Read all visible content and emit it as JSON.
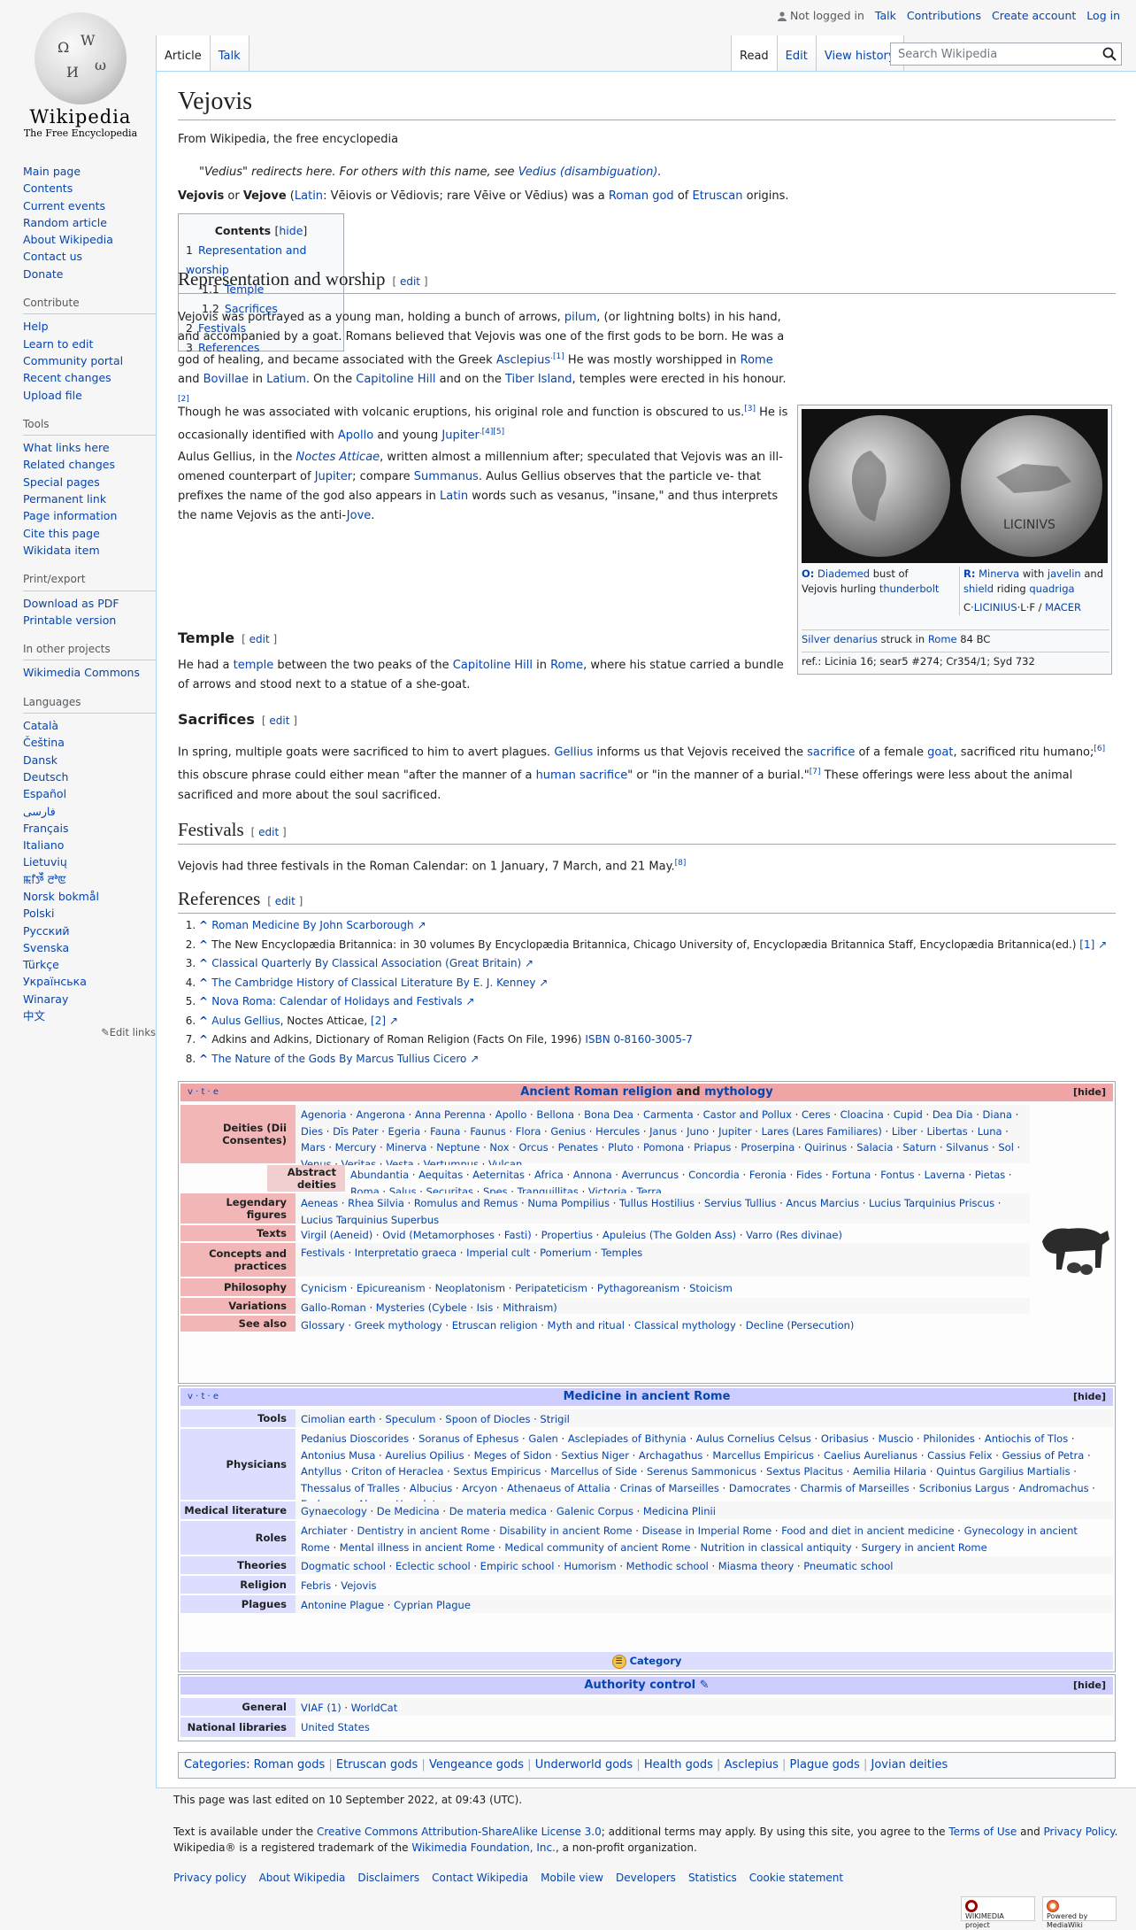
{
  "branding": {
    "wordmark": "Wikipedia",
    "tagline": "The Free Encyclopedia"
  },
  "personal": {
    "not_logged_in": "Not logged in",
    "talk": "Talk",
    "contributions": "Contributions",
    "create_account": "Create account",
    "login": "Log in"
  },
  "tabs": {
    "article": "Article",
    "talk": "Talk",
    "read": "Read",
    "edit": "Edit",
    "history": "View history"
  },
  "search": {
    "placeholder": "Search Wikipedia"
  },
  "sidebar": {
    "main": [
      "Main page",
      "Contents",
      "Current events",
      "Random article",
      "About Wikipedia",
      "Contact us",
      "Donate"
    ],
    "contribute_heading": "Contribute",
    "contribute": [
      "Help",
      "Learn to edit",
      "Community portal",
      "Recent changes",
      "Upload file"
    ],
    "tools_heading": "Tools",
    "tools": [
      "What links here",
      "Related changes",
      "Special pages",
      "Permanent link",
      "Page information",
      "Cite this page",
      "Wikidata item"
    ],
    "print_heading": "Print/export",
    "print": [
      "Download as PDF",
      "Printable version"
    ],
    "projects_heading": "In other projects",
    "projects": [
      "Wikimedia Commons"
    ],
    "languages_heading": "Languages",
    "languages": [
      "Català",
      "Čeština",
      "Dansk",
      "Deutsch",
      "Español",
      "فارسی",
      "Français",
      "Italiano",
      "Lietuvių",
      "ꯃꯤꯇꯩ ꯂꯣꯟ",
      "Norsk bokmål",
      "Polski",
      "Русский",
      "Svenska",
      "Türkçe",
      "Українська",
      "Winaray",
      "中文"
    ],
    "edit_links": "Edit links"
  },
  "article": {
    "title": "Vejovis",
    "from": "From Wikipedia, the free encyclopedia",
    "hatnote_pre": "\"Vedius\" redirects here. For others with this name, see ",
    "hatnote_link": "Vedius (disambiguation)",
    "hatnote_post": ".",
    "lead_bold1": "Vejovis",
    "lead_or": " or ",
    "lead_bold2": "Vejove",
    "lead_paren1": " (",
    "lead_latin": "Latin",
    "lead_forms": ": Vēiovis or Vēdiovis; rare Vēive or Vēdius) was a ",
    "lead_roman_god": "Roman god",
    "lead_of": " of ",
    "lead_etruscan": "Etruscan",
    "lead_end": " origins."
  },
  "toc": {
    "title": "Contents",
    "hide": "hide",
    "items": [
      {
        "num": "1",
        "label": "Representation and worship"
      },
      {
        "num": "1.1",
        "label": "Temple"
      },
      {
        "num": "1.2",
        "label": "Sacrifices"
      },
      {
        "num": "2",
        "label": "Festivals"
      },
      {
        "num": "3",
        "label": "References"
      }
    ]
  },
  "sections": {
    "rep_heading": "Representation and worship",
    "edit": "edit",
    "p1a": "Vejovis was portrayed as a young man, holding a bunch of arrows, ",
    "p1_pilum": "pilum",
    "p1b": ", (or lightning bolts) in his hand, and accompanied by a goat. Romans believed that Vejovis was one of the first gods to be born. He was a god of healing, and became associated with the Greek ",
    "p1_asclepius": "Asclepius",
    "p1_ref1": ".[1]",
    "p1c": " He was mostly worshipped in ",
    "p1_rome": "Rome",
    "p1_and": " and ",
    "p1_bovillae": "Bovillae",
    "p1_in": " in ",
    "p1_latium": "Latium",
    "p1d": ". On the ",
    "p1_capitoline": "Capitoline Hill",
    "p1e": " and on the ",
    "p1_tiber": "Tiber Island",
    "p1f": ", temples were erected in his honour.",
    "p1_ref2": "[2]",
    "p2a": "Though he was associated with volcanic eruptions, his original role and function is obscured to us.",
    "p2_ref3": "[3]",
    "p2b": " He is occasionally identified with ",
    "p2_apollo": "Apollo",
    "p2c": " and young ",
    "p2_jupiter": "Jupiter",
    "p2_ref45": ".[4][5]",
    "p3a": "Aulus Gellius, in the ",
    "p3_noctes": "Noctes Atticae",
    "p3b": ", written almost a millennium after; speculated that Vejovis was an ill-omened counterpart of ",
    "p3_jupiter": "Jupiter",
    "p3c": "; compare ",
    "p3_summanus": "Summanus",
    "p3d": ". Aulus Gellius observes that the particle ve- that prefixes the name of the god also appears in ",
    "p3_latin": "Latin",
    "p3e": " words such as vesanus, \"insane,\" and thus interprets the name Vejovis as the anti-",
    "p3_jove": "Jove",
    "p3f": ".",
    "temple_heading": "Temple",
    "t1a": "He had a ",
    "t1_temple": "temple",
    "t1b": " between the two peaks of the ",
    "t1_capitoline": "Capitoline Hill",
    "t1c": " in ",
    "t1_rome": "Rome",
    "t1d": ", where his statue carried a bundle of arrows and stood next to a statue of a she-goat.",
    "sacrifices_heading": "Sacrifices",
    "s1a": "In spring, multiple goats were sacrificed to him to avert plagues. ",
    "s1_gellius": "Gellius",
    "s1b": " informs us that Vejovis received the ",
    "s1_sacrifice": "sacrifice",
    "s1c": " of a female ",
    "s1_goat": "goat",
    "s1d": ", sacrificed ritu humano;",
    "s1_ref6": "[6]",
    "s1e": " this obscure phrase could either mean \"after the manner of a ",
    "s1_human": "human sacrifice",
    "s1f": "\" or \"in the manner of a burial.\"",
    "s1_ref7": "[7]",
    "s1g": " These offerings were less about the animal sacrificed and more about the soul sacrificed.",
    "festivals_heading": "Festivals",
    "f1": "Vejovis had three festivals in the Roman Calendar: on 1 January, 7 March, and 21 May.",
    "f1_ref8": "[8]",
    "references_heading": "References"
  },
  "infobox": {
    "o_label": "O:",
    "o_diademed": "Diademed",
    "o_text": " bust of Vejovis hurling ",
    "o_thunderbolt": "thunderbolt",
    "r_label": "R:",
    "r_minerva": "Minerva",
    "r_with": " with ",
    "r_javelin": "javelin",
    "r_and": " and ",
    "r_shield": "shield",
    "r_riding": " riding ",
    "r_quadriga": "quadriga",
    "r_legend_c": "C·",
    "r_licinius": "LICINIUS",
    "r_lf": "·L·F / ",
    "r_macer": "MACER",
    "denarius": "Silver denarius",
    "struck": " struck in ",
    "rome": "Rome",
    "year": " 84 BC",
    "ref": "ref.: Licinia 16; sear5 #274; Cr354/1; Syd 732",
    "coin_legend": "LICINIVS"
  },
  "references": [
    {
      "text": "Roman Medicine By John Scarborough",
      "type": "link"
    },
    {
      "text": "The New Encyclopædia Britannica: in 30 volumes By Encyclopædia Britannica, Chicago University of, Encyclopædia Britannica Staff, Encyclopædia Britannica(ed.) ",
      "link": "[1]",
      "type": "mixed"
    },
    {
      "text": "Classical Quarterly By Classical Association (Great Britain)",
      "type": "link"
    },
    {
      "text": "The Cambridge History of Classical Literature By E. J. Kenney",
      "type": "link"
    },
    {
      "text": "Nova Roma: Calendar of Holidays and Festivals",
      "type": "link"
    },
    {
      "text": "Aulus Gellius",
      "rest": ", Noctes Atticae, ",
      "link": "[2]",
      "type": "gellius"
    },
    {
      "text": "Adkins and Adkins, Dictionary of Roman Religion (Facts On File, 1996) ",
      "link": "ISBN 0-8160-3005-7",
      "type": "isbn"
    },
    {
      "text": "The Nature of the Gods By Marcus Tullius Cicero",
      "type": "link"
    }
  ],
  "navbox_religion": {
    "vte": "v · t · e",
    "title_a": "Ancient Roman religion",
    "title_and": " and ",
    "title_b": "mythology",
    "hide": "[hide]",
    "rows": [
      {
        "group": "Deities (Dii Consentes)",
        "items": "Agenoria · Angerona · Anna Perenna · Apollo · Bellona · Bona Dea · Carmenta · Castor and Pollux · Ceres · Cloacina · Cupid · Dea Dia · Diana · Dies · Dīs Pater · Egeria · Fauna · Faunus · Flora · Genius · Hercules · Janus · Juno · Jupiter · Lares (Lares Familiares) · Liber · Libertas · Luna · Mars · Mercury · Minerva · Neptune · Nox · Orcus · Penates · Pluto · Pomona · Priapus · Proserpina · Quirinus · Salacia · Saturn · Silvanus · Sol · Venus · Veritas · Vesta · Vertumnus · Vulcan"
      },
      {
        "group": "Abstract deities",
        "items": "Abundantia · Aequitas · Aeternitas · Africa · Annona · Averruncus · Concordia · Feronia · Fides · Fortuna · Fontus · Laverna · Pietas · Roma · Salus · Securitas · Spes · Tranquillitas · Victoria · Terra"
      },
      {
        "group": "Legendary figures",
        "items": "Aeneas · Rhea Silvia · Romulus and Remus · Numa Pompilius · Tullus Hostilius · Servius Tullius · Ancus Marcius · Lucius Tarquinius Priscus · Lucius Tarquinius Superbus"
      },
      {
        "group": "Texts",
        "items": "Virgil (Aeneid) · Ovid (Metamorphoses · Fasti) · Propertius · Apuleius (The Golden Ass) · Varro (Res divinae)"
      },
      {
        "group": "Concepts and practices",
        "items": "Festivals · Interpretatio graeca · Imperial cult · Pomerium · Temples"
      },
      {
        "group": "Philosophy",
        "items": "Cynicism · Epicureanism · Neoplatonism · Peripateticism · Pythagoreanism · Stoicism"
      },
      {
        "group": "Variations",
        "items": "Gallo-Roman · Mysteries (Cybele · Isis · Mithraism)"
      },
      {
        "group": "See also",
        "items": "Glossary · Greek mythology · Etruscan religion · Myth and ritual · Classical mythology · Decline (Persecution)"
      }
    ]
  },
  "navbox_medicine": {
    "vte": "v · t · e",
    "title": "Medicine in ancient Rome",
    "hide": "[hide]",
    "rows": [
      {
        "group": "Tools",
        "items": "Cimolian earth · Speculum · Spoon of Diocles · Strigil"
      },
      {
        "group": "Physicians",
        "items": "Pedanius Dioscorides · Soranus of Ephesus · Galen · Asclepiades of Bithynia · Aulus Cornelius Celsus · Oribasius · Muscio · Philonides · Antiochis of Tlos · Antonius Musa · Aurelius Opilius · Meges of Sidon · Sextius Niger · Archagathus · Marcellus Empiricus · Caelius Aurelianus · Cassius Felix · Gessius of Petra · Antyllus · Criton of Heraclea · Sextus Empiricus · Marcellus of Side · Serenus Sammonicus · Sextus Placitus · Aemilia Hilaria · Quintus Gargilius Martialis · Thessalus of Tralles · Albucius · Arcyon · Athenaeus of Attalia · Crinas of Marseilles · Damocrates · Charmis of Marseilles · Scribonius Largus · Andromachus · Eudemus · Alcon · Herodotus"
      },
      {
        "group": "Medical literature",
        "items": "Gynaecology · De Medicina · De materia medica · Galenic Corpus · Medicina Plinii"
      },
      {
        "group": "Roles",
        "items": "Archiater · Dentistry in ancient Rome · Disability in ancient Rome · Disease in Imperial Rome · Food and diet in ancient medicine · Gynecology in ancient Rome · Mental illness in ancient Rome · Medical community of ancient Rome · Nutrition in classical antiquity · Surgery in ancient Rome"
      },
      {
        "group": "Theories",
        "items": "Dogmatic school · Eclectic school · Empiric school · Humorism · Methodic school · Miasma theory · Pneumatic school"
      },
      {
        "group": "Religion",
        "items": "Febris · Vejovis"
      },
      {
        "group": "Plagues",
        "items": "Antonine Plague · Cyprian Plague"
      }
    ],
    "category": "Category"
  },
  "navbox_authority": {
    "title": "Authority control",
    "hide": "[hide]",
    "rows": [
      {
        "group": "General",
        "items": "VIAF (1) · WorldCat"
      },
      {
        "group": "National libraries",
        "items": "United States"
      }
    ]
  },
  "categories": {
    "label": "Categories",
    "items": [
      "Roman gods",
      "Etruscan gods",
      "Vengeance gods",
      "Underworld gods",
      "Health gods",
      "Asclepius",
      "Plague gods",
      "Jovian deities"
    ]
  },
  "footer": {
    "last_edited": "This page was last edited on 10 September 2022, at 09:43 (UTC).",
    "license_a": "Text is available under the ",
    "license_link": "Creative Commons Attribution-ShareAlike License 3.0",
    "license_b": "; additional terms may apply. By using this site, you agree to the ",
    "terms": "Terms of Use",
    "and": " and ",
    "privacy": "Privacy Policy",
    "license_c": ". Wikipedia® is a registered trademark of the ",
    "foundation": "Wikimedia Foundation, Inc.",
    "license_d": ", a non-profit organization.",
    "links": [
      "Privacy policy",
      "About Wikipedia",
      "Disclaimers",
      "Contact Wikipedia",
      "Mobile view",
      "Developers",
      "Statistics",
      "Cookie statement"
    ],
    "wikimedia_badge": "WIKIMEDIA project",
    "mediawiki_badge": "Powered by MediaWiki"
  },
  "colors": {
    "link": "#0645ad",
    "religion_header": "#efa5a5",
    "religion_group": "#f2b6b6",
    "medicine_header": "#ccccff",
    "medicine_group": "#ddddff"
  }
}
